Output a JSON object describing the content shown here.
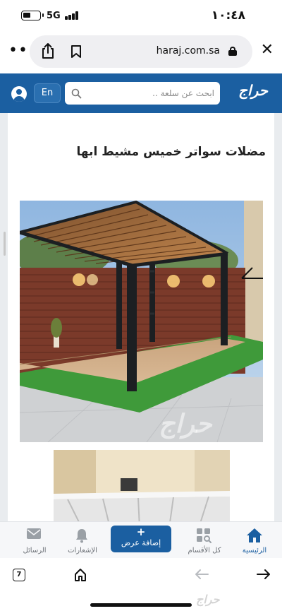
{
  "status_bar": {
    "time": "١٠:٤٨",
    "network": "5G",
    "battery_icon": "battery-icon"
  },
  "browser": {
    "url": "haraj.com.sa",
    "more_icon": "more-icon",
    "share_icon": "share-icon",
    "bookmark_icon": "bookmark-icon",
    "close_icon": "close-icon"
  },
  "site_header": {
    "logo": "حراج",
    "search_placeholder": "ابحث عن سلعة ..",
    "lang_label": "En",
    "brand_color": "#1b5fa1"
  },
  "post": {
    "title": "مضلات سواتر خميس مشيط ابها"
  },
  "photos": {
    "watermark": "حراج"
  },
  "bottom_nav": {
    "items": [
      {
        "label": "الرئيسية",
        "icon": "home-icon",
        "active": true
      },
      {
        "label": "كل الأقسام",
        "icon": "categories-icon",
        "active": false
      },
      {
        "label": "إضافة عرض",
        "icon": "plus-icon",
        "active": false
      },
      {
        "label": "الإشعارات",
        "icon": "bell-icon",
        "active": false
      },
      {
        "label": "الرسائل",
        "icon": "mail-icon",
        "active": false
      }
    ],
    "add_plus": "+"
  },
  "browser_toolbar": {
    "tabs_count": "7",
    "watermark": "حراج"
  }
}
